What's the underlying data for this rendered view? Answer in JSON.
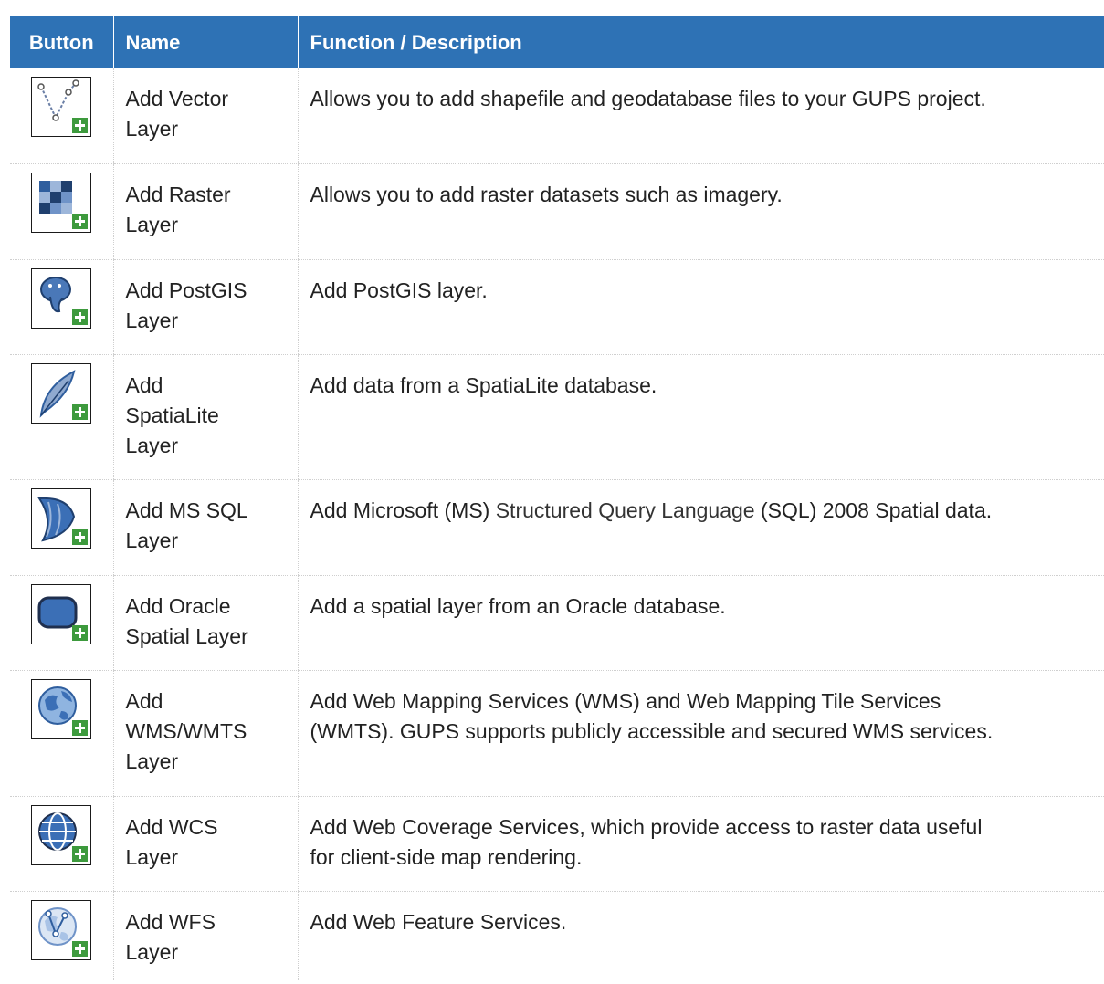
{
  "header": {
    "button": "Button",
    "name": "Name",
    "description": "Function / Description"
  },
  "rows": [
    {
      "icon": "add-vector-layer-icon",
      "name_lines": [
        "Add Vector",
        "Layer"
      ],
      "desc_lines": [
        "Allows you to add shapefile and geodatabase files to your GUPS project."
      ]
    },
    {
      "icon": "add-raster-layer-icon",
      "name_lines": [
        "Add Raster",
        "Layer"
      ],
      "desc_lines": [
        "Allows you to add raster datasets such as imagery."
      ]
    },
    {
      "icon": "add-postgis-layer-icon",
      "name_lines": [
        "Add PostGIS",
        "Layer"
      ],
      "desc_lines": [
        "Add PostGIS layer."
      ]
    },
    {
      "icon": "add-spatialite-layer-icon",
      "name_lines": [
        "Add",
        "SpatiaLite",
        "Layer"
      ],
      "desc_lines": [
        "Add data from a SpatiaLite database."
      ]
    },
    {
      "icon": "add-mssql-layer-icon",
      "name_lines": [
        "Add MS SQL",
        "Layer"
      ],
      "desc_parts": [
        "Add Microsoft (MS) ",
        "Structured Query Language",
        " (SQL) 2008 Spatial data."
      ]
    },
    {
      "icon": "add-oracle-layer-icon",
      "name_lines": [
        "Add Oracle",
        "Spatial Layer"
      ],
      "desc_lines": [
        "Add a spatial layer from an Oracle database."
      ]
    },
    {
      "icon": "add-wms-layer-icon",
      "name_lines": [
        "Add",
        "WMS/WMTS",
        "Layer"
      ],
      "desc_lines": [
        "Add Web Mapping Services (WMS) and Web Mapping Tile Services",
        "(WMTS). GUPS supports publicly accessible and secured WMS services."
      ]
    },
    {
      "icon": "add-wcs-layer-icon",
      "name_lines": [
        "Add WCS",
        "Layer"
      ],
      "desc_lines": [
        "Add Web Coverage Services, which provide access to raster data useful",
        "for client-side map rendering."
      ]
    },
    {
      "icon": "add-wfs-layer-icon",
      "name_lines": [
        "Add WFS",
        "Layer"
      ],
      "desc_lines": [
        "Add Web Feature Services."
      ]
    }
  ],
  "colors": {
    "header_bg": "#2e72b5",
    "header_text": "#ffffff",
    "plus_badge": "#3d9a3d",
    "icon_blue": "#2f5e9e"
  }
}
